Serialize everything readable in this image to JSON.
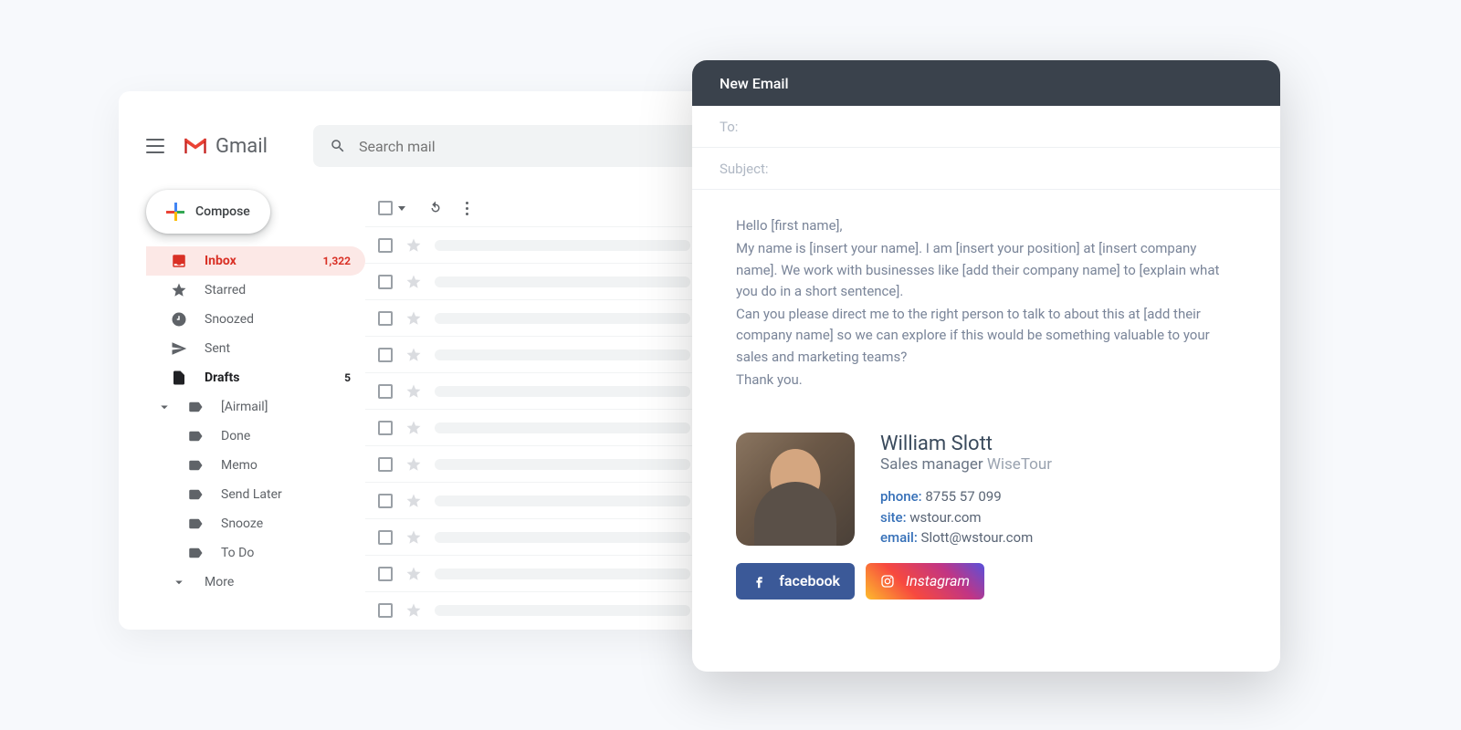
{
  "gmail": {
    "brand": "Gmail",
    "search_placeholder": "Search mail",
    "compose": "Compose",
    "sidebar": {
      "inbox": {
        "label": "Inbox",
        "count": "1,322"
      },
      "starred": {
        "label": "Starred"
      },
      "snoozed": {
        "label": "Snoozed"
      },
      "sent": {
        "label": "Sent"
      },
      "drafts": {
        "label": "Drafts",
        "count": "5"
      },
      "airmail": {
        "label": "[Airmail]"
      },
      "done": {
        "label": "Done"
      },
      "memo": {
        "label": "Memo"
      },
      "send_later": {
        "label": "Send Later"
      },
      "snooze": {
        "label": "Snooze"
      },
      "todo": {
        "label": "To Do"
      },
      "more": {
        "label": "More"
      }
    }
  },
  "compose": {
    "title": "New Email",
    "to_label": "To:",
    "subject_label": "Subject:",
    "body": {
      "line1": "Hello [first name],",
      "line2": "My name is [insert your name]. I am [insert your position] at [insert company name]. We work with businesses like [add their company name] to [explain what you do in a short sentence].",
      "line3": "Can you please direct me to the right person to talk to about this at [add their company name] so we can explore if this would be something valuable to your sales and marketing teams?",
      "line4": "Thank you."
    },
    "signature": {
      "name": "William Slott",
      "role": "Sales manager",
      "company": "WiseTour",
      "phone_label": "phone:",
      "phone": "8755 57 099",
      "site_label": "site:",
      "site": "wstour.com",
      "email_label": "email:",
      "email": "Slott@wstour.com"
    },
    "social": {
      "facebook": "facebook",
      "instagram": "Instagram"
    }
  }
}
